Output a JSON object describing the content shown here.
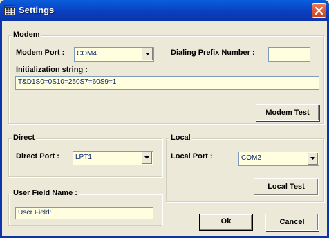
{
  "window": {
    "title": "Settings"
  },
  "modem": {
    "legend": "Modem",
    "port_label": "Modem Port :",
    "port_value": "COM4",
    "prefix_label": "Dialing Prefix Number :",
    "prefix_value": "",
    "init_label": "Initialization string :",
    "init_value": "T&D1S0=0S10=250S7=60S9=1",
    "test_button": "Modem Test"
  },
  "direct": {
    "legend": "Direct",
    "port_label": "Direct Port :",
    "port_value": "LPT1"
  },
  "local": {
    "legend": "Local",
    "port_label": "Local Port :",
    "port_value": "COM2",
    "test_button": "Local Test"
  },
  "user_field": {
    "legend": "User Field Name :",
    "value": "User Field:"
  },
  "buttons": {
    "ok": "Ok",
    "cancel": "Cancel"
  }
}
